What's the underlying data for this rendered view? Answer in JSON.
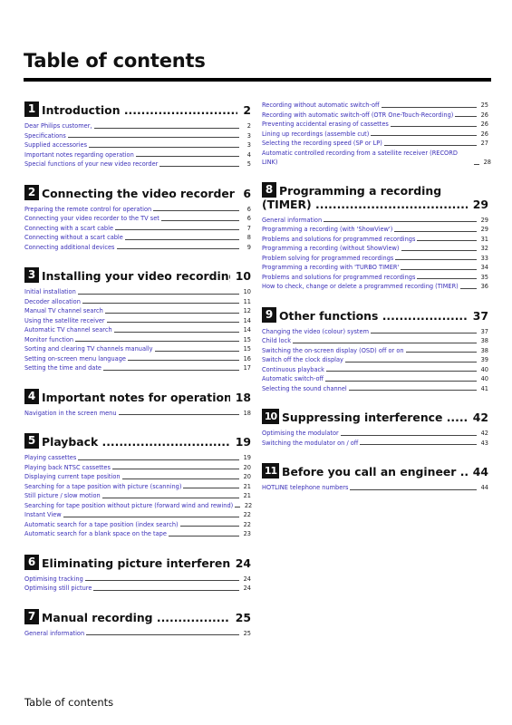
{
  "page_title": "Table of contents",
  "footer": "Table of contents",
  "link_color": "#3a2fb8",
  "left_column": [
    {
      "number": "1",
      "title": "Introduction",
      "page": "2",
      "items": [
        {
          "label": "Dear Philips customer,",
          "page": "2"
        },
        {
          "label": "Specifications",
          "page": "3"
        },
        {
          "label": "Supplied accessories",
          "page": "3"
        },
        {
          "label": "Important notes regarding operation",
          "page": "4"
        },
        {
          "label": "Special functions of your new video recorder",
          "page": "5"
        }
      ]
    },
    {
      "number": "2",
      "title": "Connecting the video recorder",
      "page": "6",
      "items": [
        {
          "label": "Preparing the remote control for operation",
          "page": "6"
        },
        {
          "label": "Connecting your video recorder to the TV set",
          "page": "6"
        },
        {
          "label": "Connecting with a scart cable",
          "page": "7"
        },
        {
          "label": "Connecting without a scart cable",
          "page": "8"
        },
        {
          "label": "Connecting additional devices",
          "page": "9"
        }
      ]
    },
    {
      "number": "3",
      "title": "Installing your video recording",
      "page": "10",
      "items": [
        {
          "label": "Initial installation",
          "page": "10"
        },
        {
          "label": "Decoder allocation",
          "page": "11"
        },
        {
          "label": "Manual TV channel search",
          "page": "12"
        },
        {
          "label": "Using the satellite receiver",
          "page": "14"
        },
        {
          "label": "Automatic TV channel search",
          "page": "14"
        },
        {
          "label": "Monitor function",
          "page": "15"
        },
        {
          "label": "Sorting and clearing TV channels manually",
          "page": "15"
        },
        {
          "label": "Setting on-screen menu language",
          "page": "16"
        },
        {
          "label": "Setting the time and date",
          "page": "17"
        }
      ]
    },
    {
      "number": "4",
      "title": "Important notes for operation",
      "page": "18",
      "items": [
        {
          "label": "Navigation in the screen menu",
          "page": "18"
        }
      ]
    },
    {
      "number": "5",
      "title": "Playback",
      "page": "19",
      "items": [
        {
          "label": "Playing cassettes",
          "page": "19"
        },
        {
          "label": "Playing back NTSC cassettes",
          "page": "20"
        },
        {
          "label": "Displaying current tape position",
          "page": "20"
        },
        {
          "label": "Searching for a tape position with picture (scanning)",
          "page": "21"
        },
        {
          "label": "Still picture / slow motion",
          "page": "21"
        },
        {
          "label": "Searching for tape position without picture (forward wind and rewind)",
          "page": "22"
        },
        {
          "label": "Instant View",
          "page": "22"
        },
        {
          "label": "Automatic search for a tape position (index search)",
          "page": "22"
        },
        {
          "label": "Automatic search for a blank space on the tape",
          "page": "23"
        }
      ]
    },
    {
      "number": "6",
      "title": "Eliminating picture interference",
      "page": "24",
      "items": [
        {
          "label": "Optimising tracking",
          "page": "24"
        },
        {
          "label": "Optimising still picture",
          "page": "24"
        }
      ]
    },
    {
      "number": "7",
      "title": "Manual recording",
      "page": "25",
      "items": [
        {
          "label": "General information",
          "page": "25"
        }
      ]
    }
  ],
  "right_column_continued": [
    {
      "label": "Recording without automatic switch-off",
      "page": "25"
    },
    {
      "label": "Recording with automatic switch-off (OTR One-Touch-Recording)",
      "page": "26"
    },
    {
      "label": "Preventing accidental erasing of cassettes",
      "page": "26"
    },
    {
      "label": "Lining up recordings (assemble cut)",
      "page": "26"
    },
    {
      "label": "Selecting the recording speed (SP or LP)",
      "page": "27"
    },
    {
      "label": "Automatic controlled recording from a satellite receiver (RECORD LINK)",
      "page": "28"
    }
  ],
  "right_column": [
    {
      "number": "8",
      "title_line1": "Programming a recording",
      "title": "(TIMER)",
      "page": "29",
      "items": [
        {
          "label": "General information",
          "page": "29"
        },
        {
          "label": "Programming a recording (with 'ShowView')",
          "page": "29"
        },
        {
          "label": "Problems and solutions for programmed recordings",
          "page": "31"
        },
        {
          "label": "Programming a recording (without ShowView)",
          "page": "32"
        },
        {
          "label": "Problem solving for programmed recordings",
          "page": "33"
        },
        {
          "label": "Programming a recording with 'TURBO TIMER'",
          "page": "34"
        },
        {
          "label": "Problems and solutions for programmed recordings",
          "page": "35"
        },
        {
          "label": "How to check, change or delete a programmed recording (TIMER)",
          "page": "36"
        }
      ]
    },
    {
      "number": "9",
      "title": "Other functions",
      "page": "37",
      "items": [
        {
          "label": "Changing the video (colour) system",
          "page": "37"
        },
        {
          "label": "Child lock",
          "page": "38"
        },
        {
          "label": "Switching the on-screen display (OSD) off or on",
          "page": "38"
        },
        {
          "label": "Switch off the clock display",
          "page": "39"
        },
        {
          "label": "Continuous playback",
          "page": "40"
        },
        {
          "label": "Automatic switch-off",
          "page": "40"
        },
        {
          "label": "Selecting the sound channel",
          "page": "41"
        }
      ]
    },
    {
      "number": "10",
      "title": "Suppressing interference",
      "page": "42",
      "items": [
        {
          "label": "Optimising the modulator",
          "page": "42"
        },
        {
          "label": "Switching the modulator on / off",
          "page": "43"
        }
      ]
    },
    {
      "number": "11",
      "title": "Before you call an engineer",
      "page": "44",
      "items": [
        {
          "label": "HOTLINE telephone numbers",
          "page": "44"
        }
      ]
    }
  ]
}
